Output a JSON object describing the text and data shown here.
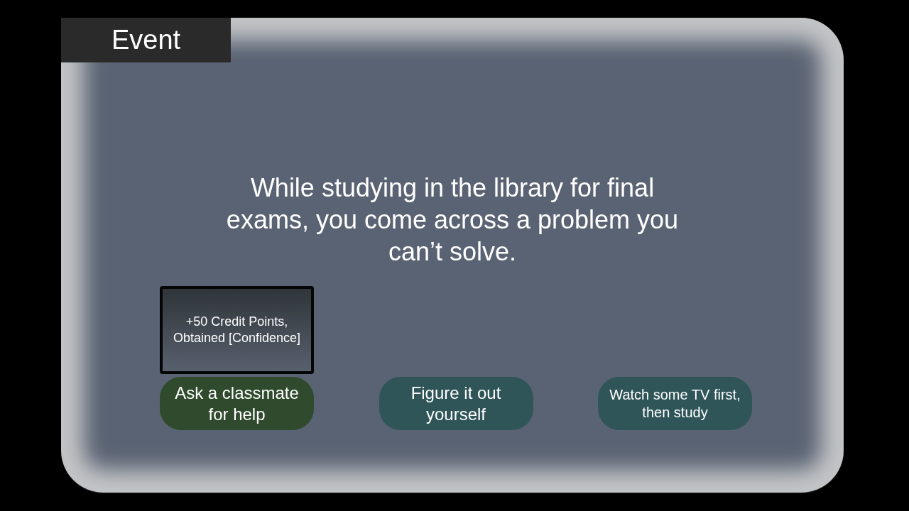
{
  "header": {
    "title": "Event"
  },
  "description": "While studying in the library for final exams, you come across a problem you can’t solve.",
  "choices": [
    {
      "label": "Ask a classmate for help",
      "selected": true,
      "result": "+50 Credit Points, Obtained [Confidence]"
    },
    {
      "label": "Figure it out yourself",
      "selected": false
    },
    {
      "label": "Watch some TV first, then study",
      "selected": false
    }
  ]
}
